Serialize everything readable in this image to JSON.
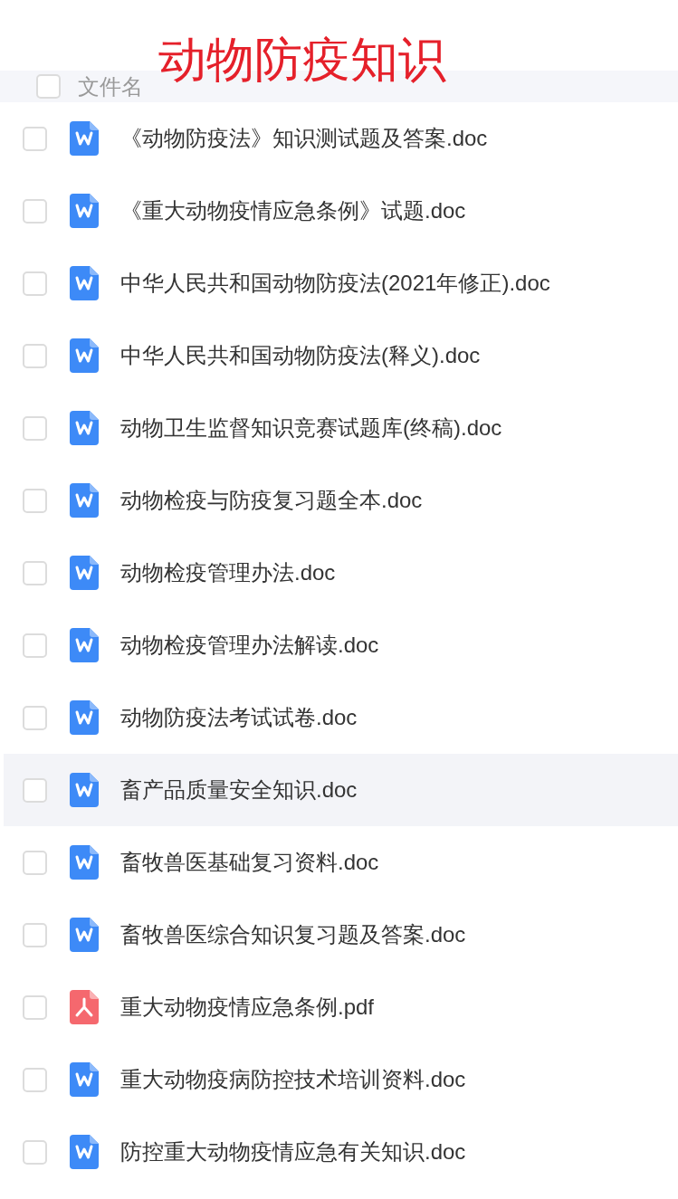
{
  "title": "动物防疫知识",
  "header": {
    "checked": false,
    "label": "文件名"
  },
  "files": [
    {
      "name": "《动物防疫法》知识测试题及答案.doc",
      "kind": "doc",
      "checked": false,
      "hovered": false
    },
    {
      "name": "《重大动物疫情应急条例》试题.doc",
      "kind": "doc",
      "checked": false,
      "hovered": false
    },
    {
      "name": "中华人民共和国动物防疫法(2021年修正).doc",
      "kind": "doc",
      "checked": false,
      "hovered": false
    },
    {
      "name": "中华人民共和国动物防疫法(释义).doc",
      "kind": "doc",
      "checked": false,
      "hovered": false
    },
    {
      "name": "动物卫生监督知识竞赛试题库(终稿).doc",
      "kind": "doc",
      "checked": false,
      "hovered": false
    },
    {
      "name": "动物检疫与防疫复习题全本.doc",
      "kind": "doc",
      "checked": false,
      "hovered": false
    },
    {
      "name": "动物检疫管理办法.doc",
      "kind": "doc",
      "checked": false,
      "hovered": false
    },
    {
      "name": "动物检疫管理办法解读.doc",
      "kind": "doc",
      "checked": false,
      "hovered": false
    },
    {
      "name": "动物防疫法考试试卷.doc",
      "kind": "doc",
      "checked": false,
      "hovered": false
    },
    {
      "name": "畜产品质量安全知识.doc",
      "kind": "doc",
      "checked": false,
      "hovered": true
    },
    {
      "name": "畜牧兽医基础复习资料.doc",
      "kind": "doc",
      "checked": false,
      "hovered": false
    },
    {
      "name": "畜牧兽医综合知识复习题及答案.doc",
      "kind": "doc",
      "checked": false,
      "hovered": false
    },
    {
      "name": "重大动物疫情应急条例.pdf",
      "kind": "pdf",
      "checked": false,
      "hovered": false
    },
    {
      "name": "重大动物疫病防控技术培训资料.doc",
      "kind": "doc",
      "checked": false,
      "hovered": false
    },
    {
      "name": "防控重大动物疫情应急有关知识.doc",
      "kind": "doc",
      "checked": false,
      "hovered": false
    }
  ]
}
